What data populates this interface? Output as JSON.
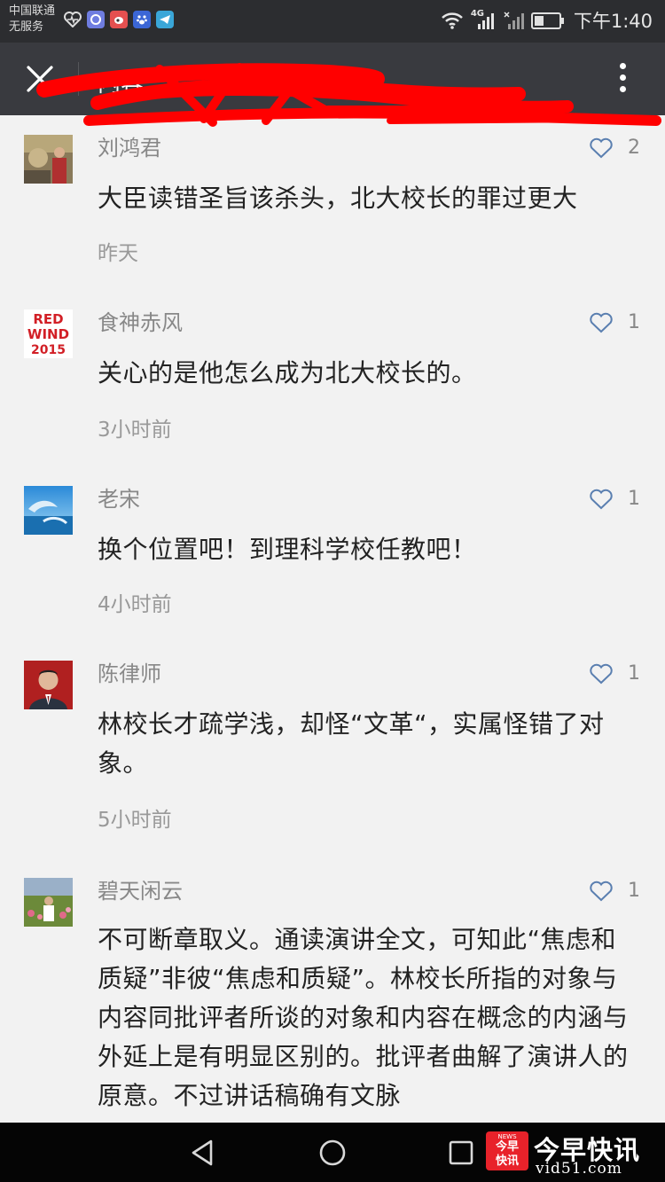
{
  "status_bar": {
    "carrier_line1": "中国联通",
    "carrier_line2": "无服务",
    "network": "4G",
    "time": "下午1:40"
  },
  "title_bar": {
    "title": "内容",
    "redacted": true
  },
  "comments": [
    {
      "name": "刘鸿君",
      "likes": "2",
      "text": "大臣读错圣旨该杀头，北大校长的罪过更大",
      "time": "昨天",
      "avatar": "photo-avatar"
    },
    {
      "name": "食神赤风",
      "likes": "1",
      "text": "关心的是他怎么成为北大校长的。",
      "time": "3小时前",
      "avatar": "logo-avatar",
      "avatar_text": [
        "RED",
        "WIND",
        "2015"
      ]
    },
    {
      "name": "老宋",
      "likes": "1",
      "text": "换个位置吧！到理科学校任教吧！",
      "time": "4小时前",
      "avatar": "dolphin-avatar"
    },
    {
      "name": "陈律师",
      "likes": "1",
      "text": "林校长才疏学浅，却怪“文革“，实属怪错了对象。",
      "time": "5小时前",
      "avatar": "portrait-avatar"
    },
    {
      "name": "碧天闲云",
      "likes": "1",
      "text": "不可断章取义。通读演讲全文，可知此“焦虑和质疑”非彼“焦虑和质疑”。林校长所指的对象与内容同批评者所谈的对象和内容在概念的内涵与外延上是有明显区别的。批评者曲解了演讲人的原意。不过讲话稿确有文脉",
      "time": "",
      "avatar": "garden-avatar"
    }
  ],
  "watermark": {
    "logo_line1": "今早",
    "logo_line2": "快讯",
    "logo_tag": "NEWS",
    "title": "今早快讯",
    "url": "vid51.com"
  },
  "colors": {
    "status_bar_bg": "#2c2d30",
    "title_bar_bg": "#393a3f",
    "page_bg": "#f2f2f2",
    "redaction": "#ff0000",
    "like_icon": "#5a7fb0"
  }
}
